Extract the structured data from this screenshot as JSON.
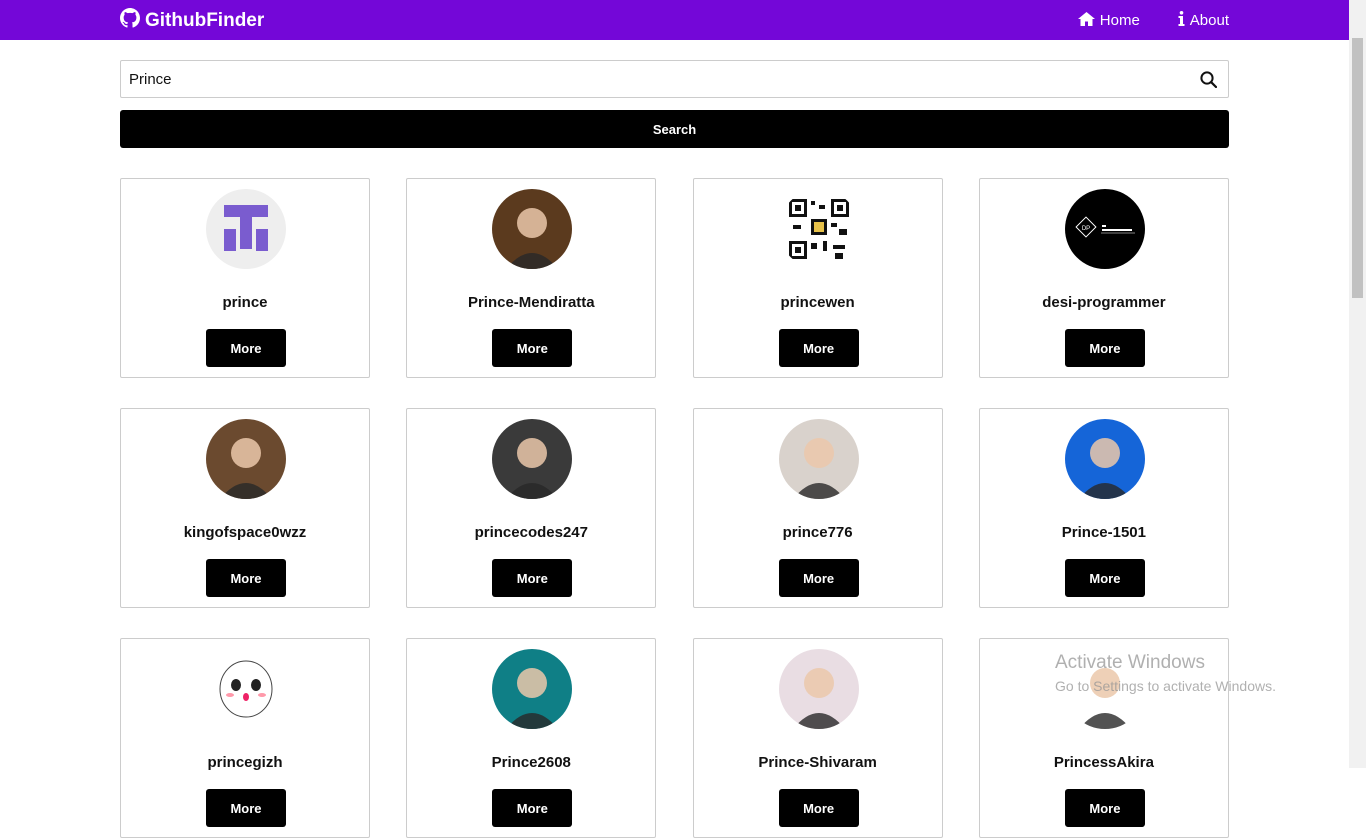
{
  "navbar": {
    "brand": "GithubFinder",
    "links": [
      {
        "label": "Home",
        "icon": "home-icon"
      },
      {
        "label": "About",
        "icon": "info-icon"
      }
    ],
    "background": "#7407d8"
  },
  "search": {
    "value": "Prince",
    "button_label": "Search"
  },
  "users": [
    {
      "login": "prince",
      "more_label": "More",
      "avatar_bg": "#eeeeee",
      "avatar_kind": "identicon"
    },
    {
      "login": "Prince-Mendiratta",
      "more_label": "More",
      "avatar_bg": "#5b3a1e",
      "avatar_kind": "photo"
    },
    {
      "login": "princewen",
      "more_label": "More",
      "avatar_bg": "#ffffff",
      "avatar_kind": "qr"
    },
    {
      "login": "desi-programmer",
      "more_label": "More",
      "avatar_bg": "#000000",
      "avatar_kind": "logo"
    },
    {
      "login": "kingofspace0wzz",
      "more_label": "More",
      "avatar_bg": "#6b4a2f",
      "avatar_kind": "photo"
    },
    {
      "login": "princecodes247",
      "more_label": "More",
      "avatar_bg": "#3a3a3a",
      "avatar_kind": "photo"
    },
    {
      "login": "prince776",
      "more_label": "More",
      "avatar_bg": "#d9d2cc",
      "avatar_kind": "photo"
    },
    {
      "login": "Prince-1501",
      "more_label": "More",
      "avatar_bg": "#1565d8",
      "avatar_kind": "photo"
    },
    {
      "login": "princegizh",
      "more_label": "More",
      "avatar_bg": "#ffffff",
      "avatar_kind": "cartoon"
    },
    {
      "login": "Prince2608",
      "more_label": "More",
      "avatar_bg": "#0f7f86",
      "avatar_kind": "photo"
    },
    {
      "login": "Prince-Shivaram",
      "more_label": "More",
      "avatar_bg": "#e9dde3",
      "avatar_kind": "photo"
    },
    {
      "login": "PrincessAkira",
      "more_label": "More",
      "avatar_bg": "#ffffff",
      "avatar_kind": "photo"
    }
  ],
  "watermark": {
    "title": "Activate Windows",
    "subtitle": "Go to Settings to activate Windows."
  }
}
